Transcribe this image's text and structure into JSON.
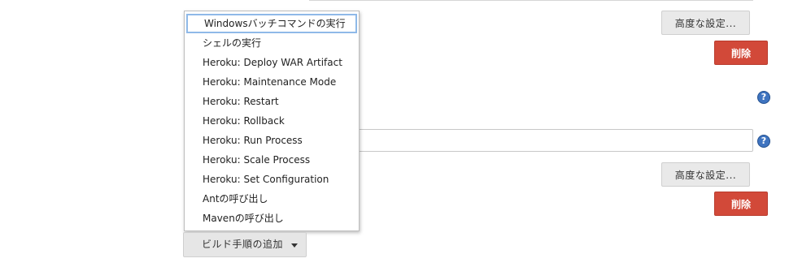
{
  "advanced_button_label": "高度な設定...",
  "delete_button_label": "削除",
  "help_icon_glyph": "?",
  "build_step_menu": {
    "items": [
      "Windowsバッチコマンドの実行",
      "シェルの実行",
      "Heroku: Deploy WAR Artifact",
      "Heroku: Maintenance Mode",
      "Heroku: Restart",
      "Heroku: Rollback",
      "Heroku: Run Process",
      "Heroku: Scale Process",
      "Heroku: Set Configuration",
      "Antの呼び出し",
      "Mavenの呼び出し"
    ],
    "selected_item": "Windowsバッチコマンドの実行"
  },
  "add_build_step_button_label": "ビルド手順の追加",
  "colors": {
    "delete_red": "#d24939",
    "help_blue": "#3f74c0",
    "selection_outline": "#8fb9e8"
  }
}
